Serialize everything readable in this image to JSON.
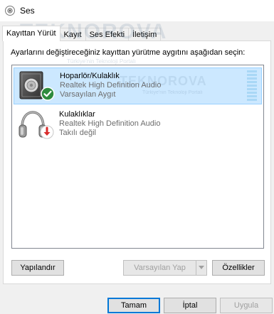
{
  "window": {
    "title": "Ses",
    "icon": "speaker-app-icon"
  },
  "tabs": [
    {
      "label": "Kayıttan Yürüt",
      "active": true
    },
    {
      "label": "Kayıt",
      "active": false
    },
    {
      "label": "Ses Efekti",
      "active": false
    },
    {
      "label": "İletişim",
      "active": false
    }
  ],
  "playback": {
    "instruction": "Ayarlarını değiştireceğiniz kayıttan yürütme aygıtını aşağıdan seçin:",
    "devices": [
      {
        "name": "Hoparlör/Kulaklık",
        "driver": "Realtek High Definition Audio",
        "status": "Varsayılan Aygıt",
        "icon": "speaker-icon",
        "badge": "default-check-icon",
        "selected": true
      },
      {
        "name": "Kulaklıklar",
        "driver": "Realtek High Definition Audio",
        "status": "Takılı değil",
        "icon": "headphones-icon",
        "badge": "unplugged-arrow-icon",
        "selected": false
      }
    ],
    "buttons": {
      "configure": "Yapılandır",
      "set_default": "Varsayılan Yap",
      "properties": "Özellikler"
    }
  },
  "dialog_buttons": {
    "ok": "Tamam",
    "cancel": "İptal",
    "apply": "Uygula"
  },
  "watermark": {
    "brand": "TEKNOROVA",
    "tagline": "Türkiye'nin Teknoloji Portalı"
  },
  "colors": {
    "selection_bg": "#cce8ff",
    "selection_border": "#99d1ff",
    "accent": "#0078d7",
    "check_badge": "#2e8b3e",
    "unplugged_badge": "#d92b2b",
    "level_meter": "#a9d7f6"
  }
}
